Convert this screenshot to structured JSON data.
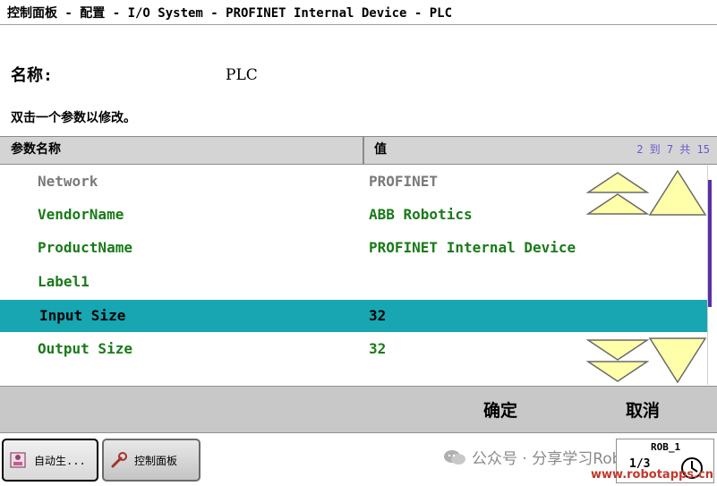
{
  "window": {
    "title": "控制面板 - 配置 - I/O System - PROFINET Internal Device - PLC"
  },
  "header": {
    "name_label": "名称:",
    "name_value": "PLC",
    "hint": "双击一个参数以修改。"
  },
  "table": {
    "col_name": "参数名称",
    "col_value": "值",
    "page_info": "2 到 7 共 15",
    "rows": [
      {
        "name": "Network",
        "value": "PROFINET",
        "state": "disabled"
      },
      {
        "name": "VendorName",
        "value": "ABB Robotics",
        "state": "normal"
      },
      {
        "name": "ProductName",
        "value": "PROFINET Internal Device",
        "state": "normal"
      },
      {
        "name": "Label1",
        "value": "",
        "state": "normal"
      },
      {
        "name": "Input Size",
        "value": "32",
        "state": "selected"
      },
      {
        "name": "Output Size",
        "value": "32",
        "state": "normal"
      }
    ]
  },
  "actions": {
    "ok_label": "确定",
    "cancel_label": "取消"
  },
  "taskbar": {
    "items": [
      {
        "label": "自动生...",
        "icon": "auto-production-icon"
      },
      {
        "label": "控制面板",
        "icon": "wrench-icon"
      }
    ],
    "rob_label": "ROB_1",
    "rob_num": "1/3"
  },
  "watermark": {
    "text": "公众号 · 分享学习Robot",
    "site": "www.robotapps.cn"
  },
  "colors": {
    "selected_row": "#17a6b2",
    "param_text": "#1a7a1a",
    "disabled_text": "#7a7a7a",
    "arrow_fill": "#ffffaa",
    "scroll_thumb": "#5b2ea6"
  }
}
